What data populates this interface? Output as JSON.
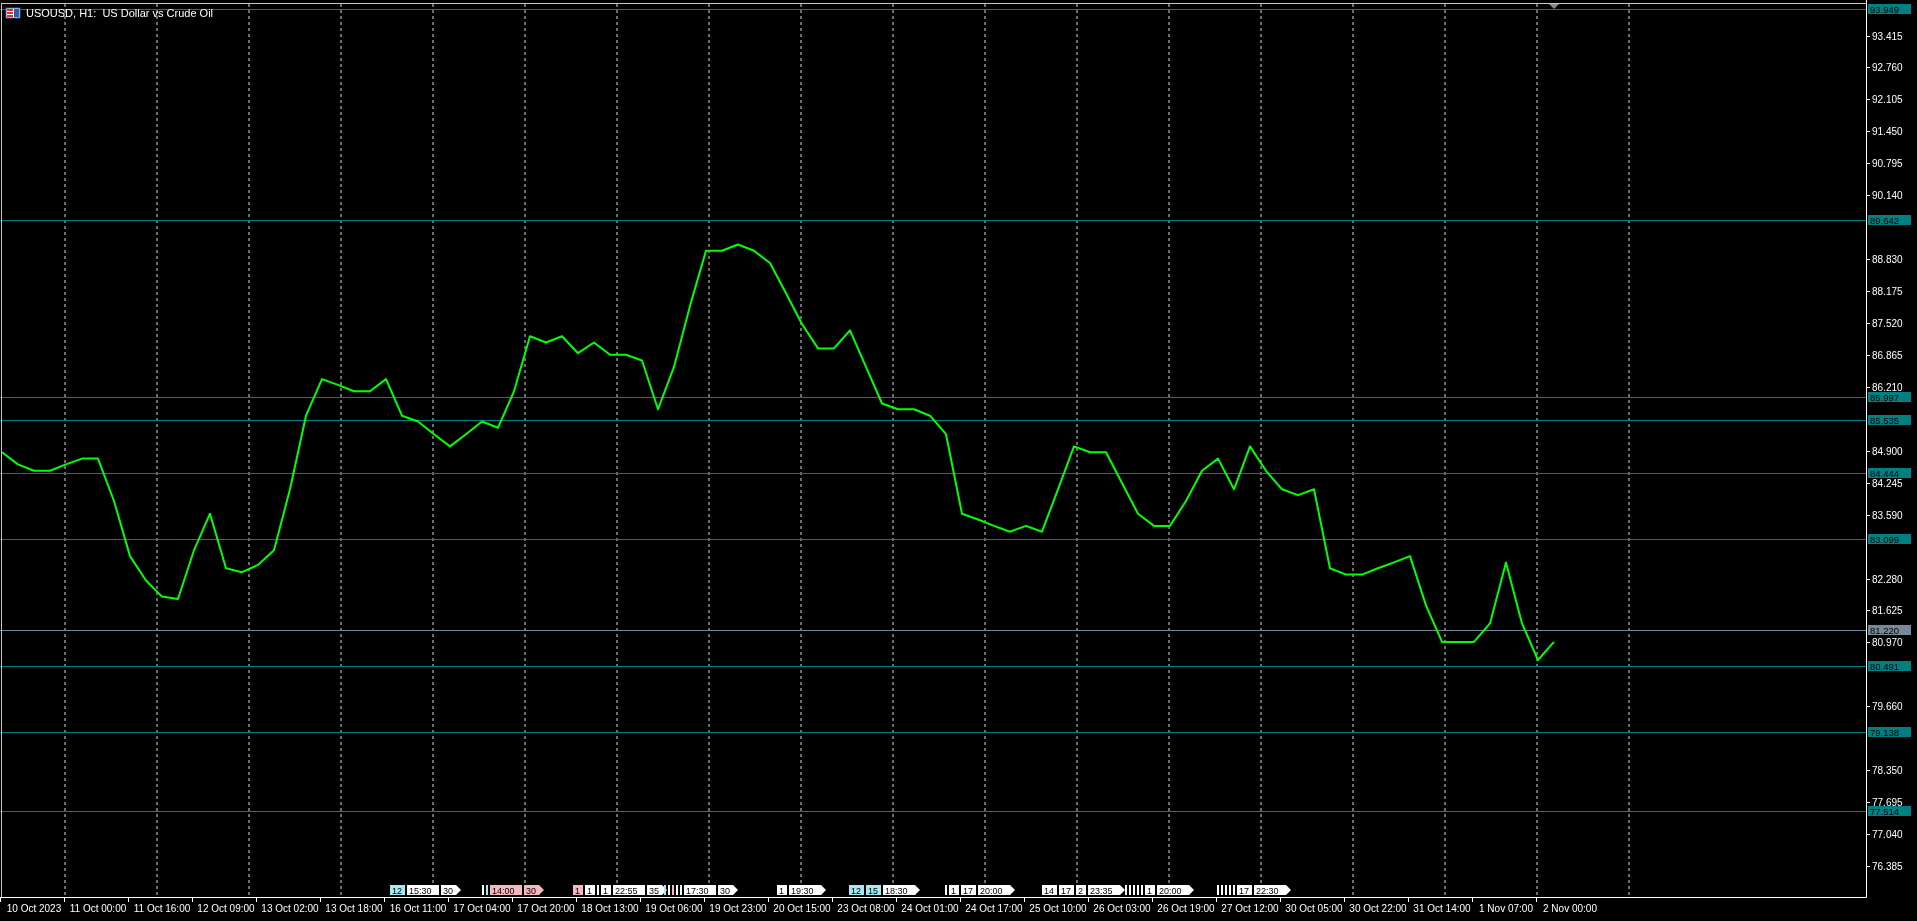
{
  "chart": {
    "title": "USOUSD, H1:  US Dollar vs Crude Oil",
    "chart_data": {
      "type": "line",
      "grid": true,
      "ylim": [
        75.75,
        94.143
      ],
      "categories": [
        null,
        null,
        "10 Oct 2023",
        null,
        null,
        null,
        "11 Oct 00:00",
        null,
        null,
        null,
        "11 Oct 16:00",
        null,
        null,
        null,
        "12 Oct 09:00",
        null,
        null,
        null,
        "13 Oct 02:00",
        null,
        null,
        null,
        "13 Oct 18:00",
        null,
        null,
        null,
        "16 Oct 11:00",
        null,
        null,
        null,
        "17 Oct 04:00",
        null,
        null,
        null,
        "17 Oct 20:00",
        null,
        null,
        null,
        "18 Oct 13:00",
        null,
        null,
        null,
        "19 Oct 06:00",
        null,
        null,
        null,
        "19 Oct 23:00",
        null,
        null,
        null,
        "20 Oct 15:00",
        null,
        null,
        null,
        "23 Oct 08:00",
        null,
        null,
        null,
        "24 Oct 01:00",
        null,
        null,
        null,
        "24 Oct 17:00",
        null,
        null,
        null,
        "25 Oct 10:00",
        null,
        null,
        null,
        "26 Oct 03:00",
        null,
        null,
        null,
        "26 Oct 19:00",
        null,
        null,
        null,
        "27 Oct 12:00",
        null,
        null,
        null,
        "30 Oct 05:00",
        null,
        null,
        null,
        "30 Oct 22:00",
        null,
        null,
        null,
        "31 Oct 14:00",
        null,
        null,
        null,
        "1 Nov 07:00",
        null,
        null,
        null,
        "2 Nov 00:00",
        null
      ],
      "yticks": [
        {
          "value": 93.415,
          "label": "93.415"
        },
        {
          "value": 92.76,
          "label": "92.760"
        },
        {
          "value": 92.105,
          "label": "92.105"
        },
        {
          "value": 91.45,
          "label": "91.450"
        },
        {
          "value": 90.795,
          "label": "90.795"
        },
        {
          "value": 90.14,
          "label": "90.140"
        },
        {
          "value": 88.83,
          "label": "88.830"
        },
        {
          "value": 88.175,
          "label": "88.175"
        },
        {
          "value": 87.52,
          "label": "87.520"
        },
        {
          "value": 86.865,
          "label": "86.865"
        },
        {
          "value": 86.21,
          "label": "86.210"
        },
        {
          "value": 84.9,
          "label": "84.900"
        },
        {
          "value": 84.245,
          "label": "84.245"
        },
        {
          "value": 83.59,
          "label": "83.590"
        },
        {
          "value": 82.28,
          "label": "82.280"
        },
        {
          "value": 81.625,
          "label": "81.625"
        },
        {
          "value": 80.97,
          "label": "80.970"
        },
        {
          "value": 79.66,
          "label": "79.660"
        },
        {
          "value": 78.35,
          "label": "78.350"
        },
        {
          "value": 77.695,
          "label": "77.695"
        },
        {
          "value": 77.04,
          "label": "77.040"
        },
        {
          "value": 76.385,
          "label": "76.385"
        }
      ],
      "series": [
        {
          "color": "#00ff00",
          "values": [
            84.87,
            84.62,
            84.49,
            84.49,
            84.62,
            84.74,
            84.74,
            83.87,
            82.74,
            82.24,
            81.91,
            81.86,
            82.86,
            83.61,
            82.49,
            82.41,
            82.56,
            82.86,
            84.11,
            85.62,
            86.37,
            86.25,
            86.12,
            86.12,
            86.37,
            85.62,
            85.5,
            85.24,
            84.99,
            85.24,
            85.5,
            85.37,
            86.12,
            87.25,
            87.12,
            87.25,
            86.9,
            87.12,
            86.87,
            86.87,
            86.75,
            85.75,
            86.62,
            87.87,
            89.0,
            89.0,
            89.13,
            89.0,
            88.75,
            88.13,
            87.5,
            87.0,
            87.0,
            87.37,
            86.62,
            85.87,
            85.75,
            85.75,
            85.62,
            85.24,
            83.61,
            83.49,
            83.36,
            83.24,
            83.36,
            83.24,
            84.11,
            84.99,
            84.87,
            84.87,
            84.24,
            83.61,
            83.36,
            83.36,
            83.87,
            84.49,
            84.74,
            84.11,
            84.99,
            84.49,
            84.11,
            83.99,
            84.11,
            82.49,
            82.36,
            82.36,
            82.49,
            82.61,
            82.74,
            81.73,
            80.98,
            80.98,
            80.98,
            81.36,
            82.61,
            81.36,
            80.61,
            80.98,
            null,
            null
          ]
        }
      ],
      "ref_lines": [
        {
          "axis": "y",
          "value": 93.949,
          "label": "93.949",
          "color": "#008080"
        },
        {
          "axis": "y",
          "value": 89.642,
          "label": "89.642",
          "color": "#008080"
        },
        {
          "axis": "y",
          "value": 85.997,
          "label": "85.997",
          "color": "#008080"
        },
        {
          "axis": "y",
          "value": 85.535,
          "label": "85.535",
          "color": "#008080"
        },
        {
          "axis": "y",
          "value": 84.444,
          "label": "84.444",
          "color": "#008080"
        },
        {
          "axis": "y",
          "value": 83.099,
          "label": "83.099",
          "color": "#008080"
        },
        {
          "axis": "y",
          "value": 81.22,
          "label": "81.220",
          "color": "#778899"
        },
        {
          "axis": "y",
          "value": 80.491,
          "label": "80.491",
          "color": "#008080"
        },
        {
          "axis": "y",
          "value": 79.138,
          "label": "79.138",
          "color": "#008080"
        },
        {
          "axis": "y",
          "value": 77.514,
          "label": "77.514",
          "color": "#008080"
        }
      ]
    }
  },
  "event_markers": [
    {
      "items": [
        {
          "kind": "tag",
          "text": "12",
          "color": "#a8e8f0"
        },
        {
          "kind": "tag",
          "text": "15:30",
          "color": "#ffffff"
        },
        {
          "kind": "arrow",
          "text": "30",
          "color": "#ffffff"
        }
      ]
    },
    {
      "items": [
        {
          "kind": "bar",
          "color": "#ffffff"
        },
        {
          "kind": "bar",
          "color": "#a8e8f0"
        },
        {
          "kind": "tag",
          "text": "14:00",
          "color": "#f4b8c0"
        },
        {
          "kind": "arrow",
          "text": "30",
          "color": "#f4b8c0"
        }
      ]
    },
    {
      "items": [
        {
          "kind": "tag",
          "text": "1",
          "color": "#f4b8c0"
        },
        {
          "kind": "tag",
          "text": "1",
          "color": "#ffffff"
        },
        {
          "kind": "bar",
          "color": "#ffffff"
        },
        {
          "kind": "tag",
          "text": "1",
          "color": "#ffffff"
        },
        {
          "kind": "tag",
          "text": "22:55",
          "color": "#ffffff"
        },
        {
          "kind": "arrow",
          "text": "35",
          "color": "#ffffff"
        }
      ]
    },
    {
      "items": [
        {
          "kind": "bar",
          "color": "#a8e8f0"
        },
        {
          "kind": "bar",
          "color": "#ffffff"
        },
        {
          "kind": "bar",
          "color": "#f4b8c0"
        },
        {
          "kind": "bar",
          "color": "#ffffff"
        },
        {
          "kind": "bar",
          "color": "#ffffff"
        },
        {
          "kind": "tag",
          "text": "17:30",
          "color": "#ffffff"
        },
        {
          "kind": "arrow",
          "text": "30",
          "color": "#ffffff"
        }
      ]
    },
    {
      "items": [
        {
          "kind": "tag",
          "text": "1",
          "color": "#ffffff"
        },
        {
          "kind": "arrow",
          "text": "19:30",
          "color": "#ffffff"
        }
      ]
    },
    {
      "items": [
        {
          "kind": "tag",
          "text": "12",
          "color": "#a8e8f0"
        },
        {
          "kind": "tag",
          "text": "15",
          "color": "#a8e8f0"
        },
        {
          "kind": "arrow",
          "text": "18:30",
          "color": "#ffffff"
        }
      ]
    },
    {
      "items": [
        {
          "kind": "bar",
          "color": "#ffffff"
        },
        {
          "kind": "tag",
          "text": "1",
          "color": "#ffffff"
        },
        {
          "kind": "tag",
          "text": "17",
          "color": "#ffffff"
        },
        {
          "kind": "arrow",
          "text": "20:00",
          "color": "#ffffff"
        }
      ]
    },
    {
      "items": [
        {
          "kind": "tag",
          "text": "14",
          "color": "#ffffff"
        },
        {
          "kind": "tag",
          "text": "17",
          "color": "#ffffff"
        },
        {
          "kind": "tag",
          "text": "2",
          "color": "#ffffff"
        },
        {
          "kind": "arrow",
          "text": "23:35",
          "color": "#ffffff"
        }
      ]
    },
    {
      "items": [
        {
          "kind": "bar",
          "color": "#ffffff"
        },
        {
          "kind": "bar",
          "color": "#ffffff"
        },
        {
          "kind": "bar",
          "color": "#ffffff"
        },
        {
          "kind": "bar",
          "color": "#ffffff"
        },
        {
          "kind": "bar",
          "color": "#ffffff"
        },
        {
          "kind": "tag",
          "text": "1",
          "color": "#ffffff"
        },
        {
          "kind": "arrow",
          "text": "20:00",
          "color": "#ffffff"
        }
      ]
    },
    {
      "items": [
        {
          "kind": "bar",
          "color": "#ffffff"
        },
        {
          "kind": "bar",
          "color": "#ffffff"
        },
        {
          "kind": "bar",
          "color": "#ffffff"
        },
        {
          "kind": "bar",
          "color": "#ffffff"
        },
        {
          "kind": "bar",
          "color": "#ffffff"
        },
        {
          "kind": "tag",
          "text": "17",
          "color": "#ffffff"
        },
        {
          "kind": "arrow",
          "text": "22:30",
          "color": "#ffffff"
        }
      ]
    }
  ]
}
